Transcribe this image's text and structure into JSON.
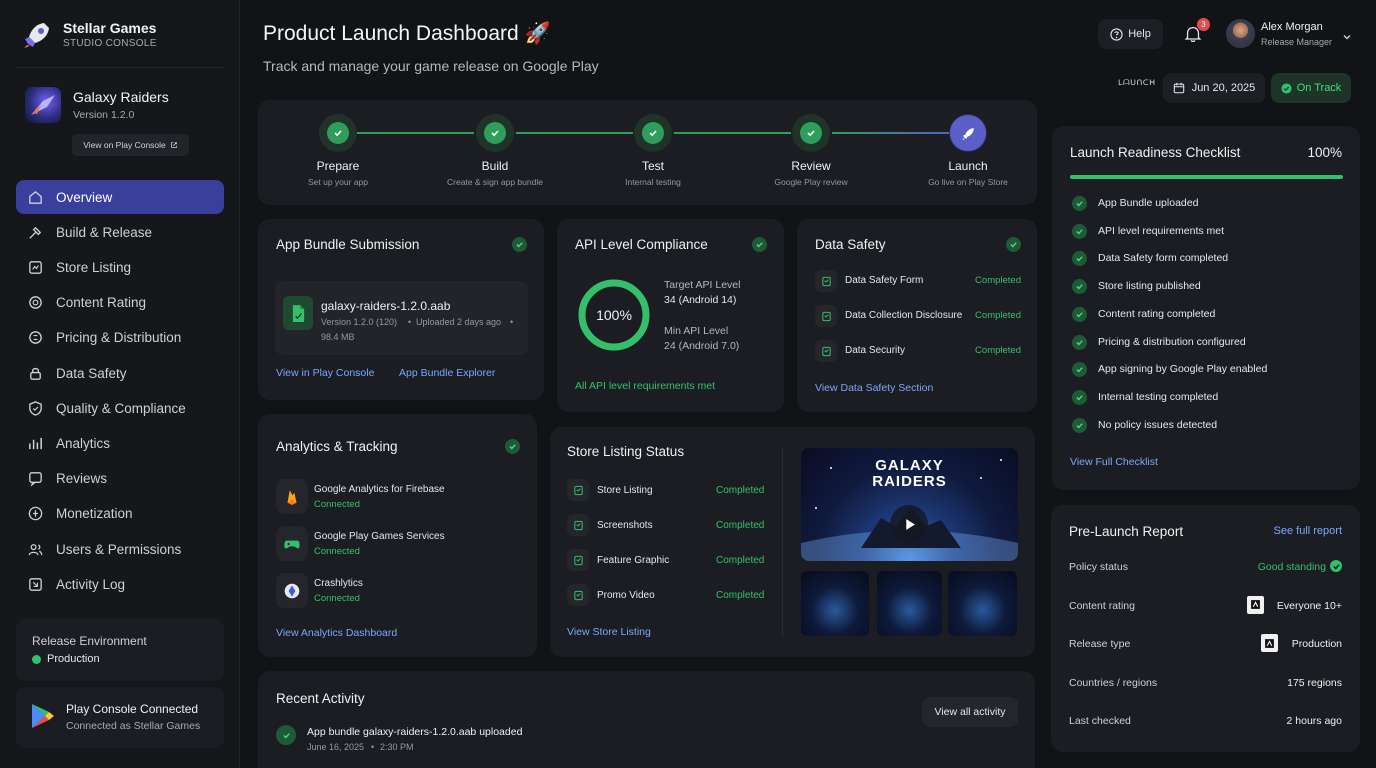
{
  "brand": {
    "name": "Stellar Games",
    "sub": "STUDIO CONSOLE"
  },
  "app": {
    "name": "Galaxy Raiders",
    "version": "Version 1.2.0",
    "console_link": "View on Play Console"
  },
  "nav": [
    {
      "label": "Overview",
      "icon": "home-icon",
      "active": true
    },
    {
      "label": "Build & Release",
      "icon": "hammer-icon"
    },
    {
      "label": "Store Listing",
      "icon": "store-icon"
    },
    {
      "label": "Content Rating",
      "icon": "rating-icon"
    },
    {
      "label": "Pricing & Distribution",
      "icon": "price-tag-icon"
    },
    {
      "label": "Data Safety",
      "icon": "lock-icon"
    },
    {
      "label": "Quality & Compliance",
      "icon": "shield-icon"
    },
    {
      "label": "Analytics",
      "icon": "bar-chart-icon"
    },
    {
      "label": "Reviews",
      "icon": "review-icon"
    },
    {
      "label": "Monetization",
      "icon": "coin-icon"
    },
    {
      "label": "Users & Permissions",
      "icon": "users-icon"
    },
    {
      "label": "Activity Log",
      "icon": "activity-icon"
    }
  ],
  "env": {
    "label": "Release Environment",
    "value": "Production"
  },
  "play_connect": {
    "title": "Play Console Connected",
    "sub": "Connected as Stellar Games"
  },
  "header": {
    "title": "Product Launch Dashboard 🚀",
    "subtitle": "Track and manage your game release on Google Play"
  },
  "topbar": {
    "help": "Help",
    "notif_count": "3",
    "user_name": "Alex Morgan",
    "user_role": "Release Manager",
    "date": "Jun 20, 2025",
    "status": "On Track",
    "logo_text": "ᒪᗩᑌᑎᑕᕼ"
  },
  "steps": [
    {
      "label": "Prepare",
      "sub": "Set up your app"
    },
    {
      "label": "Build",
      "sub": "Create & sign app bundle"
    },
    {
      "label": "Test",
      "sub": "Internal testing"
    },
    {
      "label": "Review",
      "sub": "Google Play review"
    },
    {
      "label": "Launch",
      "sub": "Go live on Play Store"
    }
  ],
  "bundle": {
    "title": "App Bundle Submission",
    "file": "galaxy-raiders-1.2.0.aab",
    "meta1": "Version 1.2.0 (120)",
    "meta2": "Uploaded 2 days ago",
    "meta3": "98.4 MB",
    "link1": "View in Play Console",
    "link2": "App Bundle Explorer"
  },
  "api": {
    "title": "API Level Compliance",
    "percent": "100%",
    "percent_value": 100,
    "target_label": "Target API Level",
    "target_value": "34 (Android 14)",
    "min_label": "Min API Level",
    "min_value": "24 (Android 7.0)",
    "footer": "All API level requirements met"
  },
  "safety": {
    "title": "Data Safety",
    "rows": [
      {
        "label": "Data Safety Form",
        "status": "Completed"
      },
      {
        "label": "Data Collection Disclosure",
        "status": "Completed"
      },
      {
        "label": "Data Security",
        "status": "Completed"
      }
    ],
    "link": "View Data Safety Section"
  },
  "analytics": {
    "title": "Analytics & Tracking",
    "items": [
      {
        "name": "Google Analytics for Firebase",
        "status": "Connected"
      },
      {
        "name": "Google Play Games Services",
        "status": "Connected"
      },
      {
        "name": "Crashlytics",
        "status": "Connected"
      }
    ],
    "link": "View Analytics Dashboard"
  },
  "store": {
    "title": "Store Listing Status",
    "rows": [
      {
        "label": "Store Listing",
        "status": "Completed"
      },
      {
        "label": "Screenshots",
        "status": "Completed"
      },
      {
        "label": "Feature Graphic",
        "status": "Completed"
      },
      {
        "label": "Promo Video",
        "status": "Completed"
      }
    ],
    "link": "View Store Listing",
    "video_title_1": "GALAXY",
    "video_title_2": "RAIDERS"
  },
  "activity": {
    "title": "Recent Activity",
    "button": "View all activity",
    "item": "App bundle galaxy-raiders-1.2.0.aab uploaded",
    "date": "June 16, 2025",
    "time": "2:30 PM"
  },
  "checklist": {
    "title": "Launch Readiness Checklist",
    "percent": "100%",
    "progress": 1.0,
    "items": [
      "App Bundle uploaded",
      "API level requirements met",
      "Data Safety form completed",
      "Store listing published",
      "Content rating completed",
      "Pricing & distribution configured",
      "App signing by Google Play enabled",
      "Internal testing completed",
      "No policy issues detected"
    ],
    "link": "View Full Checklist"
  },
  "prelaunch": {
    "title": "Pre-Launch Report",
    "link": "See full report",
    "rows": [
      {
        "label": "Policy status",
        "value": "Good standing"
      },
      {
        "label": "Content rating",
        "value": "Everyone 10+"
      },
      {
        "label": "Release type",
        "value": "Production"
      },
      {
        "label": "Countries / regions",
        "value": "175 regions"
      },
      {
        "label": "Last checked",
        "value": "2 hours ago"
      }
    ]
  },
  "colors": {
    "accent": "#3a3f9e",
    "success": "#34c06b",
    "link": "#7aa7ff",
    "bg": "#121317",
    "card": "#1c1d22"
  }
}
